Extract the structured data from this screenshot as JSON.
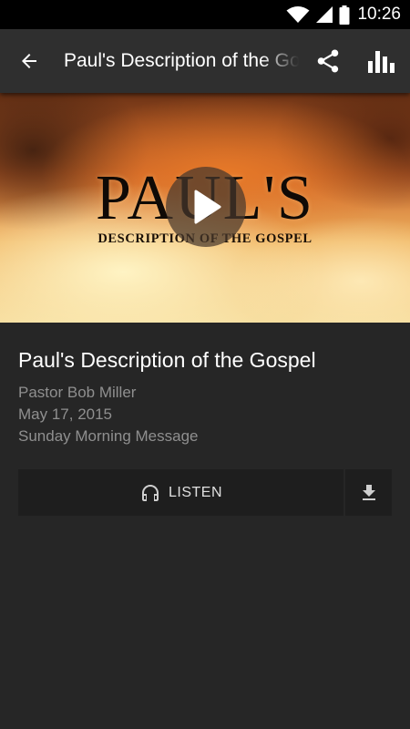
{
  "status_bar": {
    "time": "10:26",
    "icons": [
      "wifi-icon",
      "signal-icon",
      "battery-icon"
    ]
  },
  "toolbar": {
    "back_icon": "arrow-back-icon",
    "title": "Paul's Description of the Gospel",
    "share_icon": "share-icon",
    "stats_icon": "bar-chart-icon"
  },
  "hero": {
    "art_title": "PAUL'S",
    "art_subtitle": "DESCRIPTION OF THE GOSPEL",
    "play_icon": "play-icon"
  },
  "message": {
    "title": "Paul's Description of the Gospel",
    "speaker": "Pastor Bob Miller",
    "date": "May 17, 2015",
    "series": "Sunday Morning Message"
  },
  "actions": {
    "listen_label": "LISTEN",
    "listen_icon": "headphones-icon",
    "download_icon": "download-icon"
  },
  "colors": {
    "background": "#262626",
    "toolbar": "#2f2f2f",
    "button_bg": "#1e1e1e",
    "meta_text": "#8f8f8f"
  }
}
